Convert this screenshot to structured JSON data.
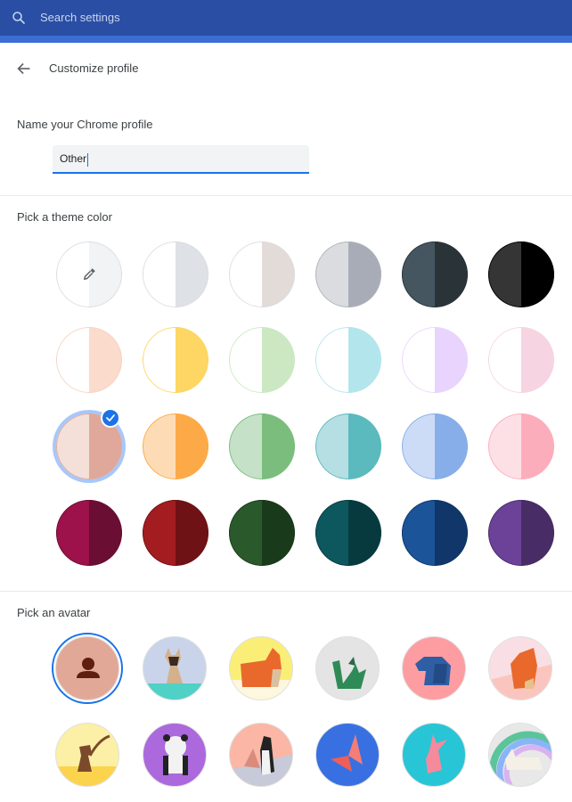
{
  "search": {
    "placeholder": "Search settings",
    "icon": "search-icon"
  },
  "header": {
    "title": "Customize profile",
    "back_icon": "arrow-back-icon"
  },
  "name_section": {
    "label": "Name your Chrome profile",
    "value": "Other"
  },
  "theme_section": {
    "label": "Pick a theme color",
    "selected_index": 12,
    "colors": [
      {
        "name": "custom-color-picker",
        "left": "#ffffff",
        "right": "#f1f3f4",
        "border": "#dadce0",
        "icon": "eyedropper-icon"
      },
      {
        "name": "grey-light",
        "left": "#ffffff",
        "right": "#dee1e6",
        "border": "#dadce0"
      },
      {
        "name": "warm-grey",
        "left": "#ffffff",
        "right": "#e3dbd7",
        "border": "#dadce0"
      },
      {
        "name": "grey",
        "left": "#dadce0",
        "right": "#a8acb6",
        "border": "#b0b3bb"
      },
      {
        "name": "blue-grey-dark",
        "left": "#455660",
        "right": "#2a3338",
        "border": "#2a3338"
      },
      {
        "name": "black",
        "left": "#353535",
        "right": "#000000",
        "border": "#000000"
      },
      {
        "name": "peach-light",
        "left": "#ffffff",
        "right": "#fbdbcc",
        "border": "#f7d2c1"
      },
      {
        "name": "yellow-light",
        "left": "#ffffff",
        "right": "#fdd663",
        "border": "#fdd663"
      },
      {
        "name": "green-light",
        "left": "#ffffff",
        "right": "#cbe8c3",
        "border": "#cbe8c3"
      },
      {
        "name": "aqua-light",
        "left": "#ffffff",
        "right": "#b3e5ec",
        "border": "#b3e5ec"
      },
      {
        "name": "lavender-light",
        "left": "#ffffff",
        "right": "#e9d4fd",
        "border": "#e9d4fd"
      },
      {
        "name": "pink-light",
        "left": "#ffffff",
        "right": "#f6d4e2",
        "border": "#f6d4e2"
      },
      {
        "name": "rose-beige",
        "left": "#f4e0d9",
        "right": "#e0a89a",
        "border": "#e0a89a"
      },
      {
        "name": "orange",
        "left": "#fddcb5",
        "right": "#fcaa48",
        "border": "#fcaa48"
      },
      {
        "name": "green",
        "left": "#c5e1c8",
        "right": "#7bbd7d",
        "border": "#7bbd7d"
      },
      {
        "name": "teal",
        "left": "#b5dfe3",
        "right": "#5bbabe",
        "border": "#5bbabe"
      },
      {
        "name": "blue",
        "left": "#ccdbf6",
        "right": "#87aee8",
        "border": "#87aee8"
      },
      {
        "name": "pink",
        "left": "#fde0e6",
        "right": "#fcadbb",
        "border": "#fcadbb"
      },
      {
        "name": "magenta-dark",
        "left": "#9d124b",
        "right": "#6a0e33",
        "border": "#6a0e33"
      },
      {
        "name": "red-dark",
        "left": "#a21c20",
        "right": "#6e1215",
        "border": "#6e1215"
      },
      {
        "name": "green-dark",
        "left": "#2a5a2c",
        "right": "#193b1b",
        "border": "#193b1b"
      },
      {
        "name": "teal-dark",
        "left": "#0d585e",
        "right": "#073a3f",
        "border": "#073a3f"
      },
      {
        "name": "blue-dark",
        "left": "#1b5498",
        "right": "#10366a",
        "border": "#10366a"
      },
      {
        "name": "purple-dark",
        "left": "#6b4298",
        "right": "#482c65",
        "border": "#482c65"
      }
    ]
  },
  "avatar_section": {
    "label": "Pick an avatar",
    "selected_index": 0,
    "avatars": [
      {
        "name": "generic-person",
        "bg": "#e2a897"
      },
      {
        "name": "origami-cat",
        "bg": "#c9d4ea"
      },
      {
        "name": "origami-corgi",
        "bg": "#fbee76"
      },
      {
        "name": "origami-dragon",
        "bg": "#e4e4e4"
      },
      {
        "name": "origami-elephant",
        "bg": "#fd9da1"
      },
      {
        "name": "origami-fox",
        "bg": "#f9dfe3"
      },
      {
        "name": "origami-monkey",
        "bg": "#fbf0a5"
      },
      {
        "name": "origami-panda",
        "bg": "#ab69dd"
      },
      {
        "name": "origami-penguin",
        "bg": "#fbb6a5"
      },
      {
        "name": "origami-butterfly",
        "bg": "#3870e1"
      },
      {
        "name": "origami-rabbit",
        "bg": "#28c5d6"
      },
      {
        "name": "origami-unicorn",
        "bg": "#e8e8e8"
      }
    ]
  },
  "colors": {
    "accent": "#1a73e8",
    "header_bg": "#2a4ea3",
    "header_strip": "#3a6dd6"
  }
}
